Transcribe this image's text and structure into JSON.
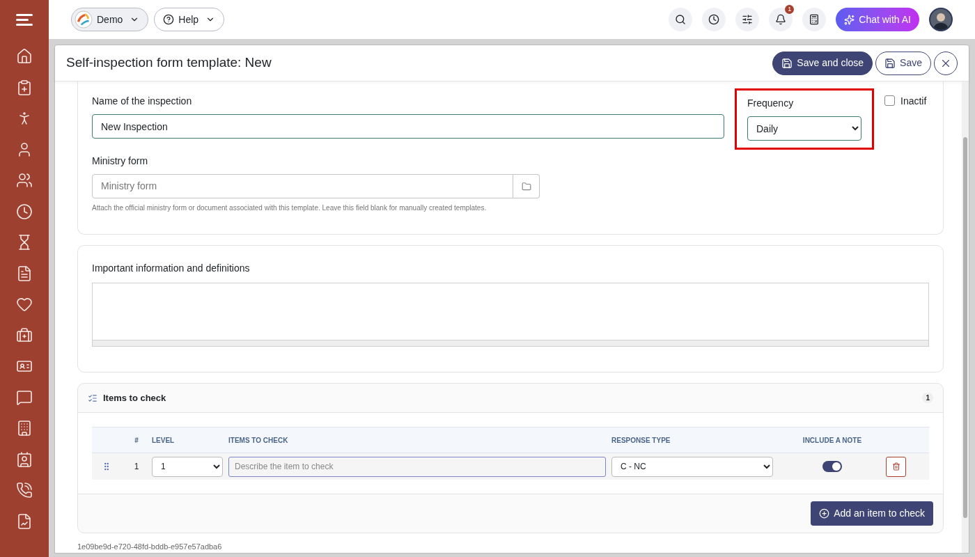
{
  "topbar": {
    "workspace": "Demo",
    "help": "Help",
    "notifications": "1",
    "chat": "Chat with AI"
  },
  "modal": {
    "title": "Self-inspection form template: New",
    "buttons": [
      {
        "kind": "primary",
        "label": "Save and close"
      },
      {
        "kind": "outline",
        "label": "Save"
      }
    ]
  },
  "general": {
    "name_label": "Name of the inspection",
    "name_value": "New Inspection",
    "frequency_label": "Frequency",
    "frequency_value": "Daily",
    "frequency_highlighted": true,
    "inactive_label": "Inactif",
    "inactive_checked": false,
    "ministry_label": "Ministry form",
    "ministry_placeholder": "Ministry form",
    "ministry_help": "Attach the official ministry form or document associated with this template. Leave this field blank for manually created templates."
  },
  "info": {
    "label": "Important information and definitions"
  },
  "items": {
    "title": "Items to check",
    "count": "1",
    "columns": [
      "#",
      "LEVEL",
      "ITEMS TO CHECK",
      "RESPONSE TYPE",
      "INCLUDE A NOTE"
    ],
    "rows": [
      {
        "number": "1",
        "level": "1",
        "placeholder": "Describe the item to check",
        "response_type": "C - NC",
        "include_note": true
      }
    ],
    "add_button": "Add an item to check"
  },
  "record_id": "1e09be9d-e720-48fd-bddb-e957e57adba6"
}
